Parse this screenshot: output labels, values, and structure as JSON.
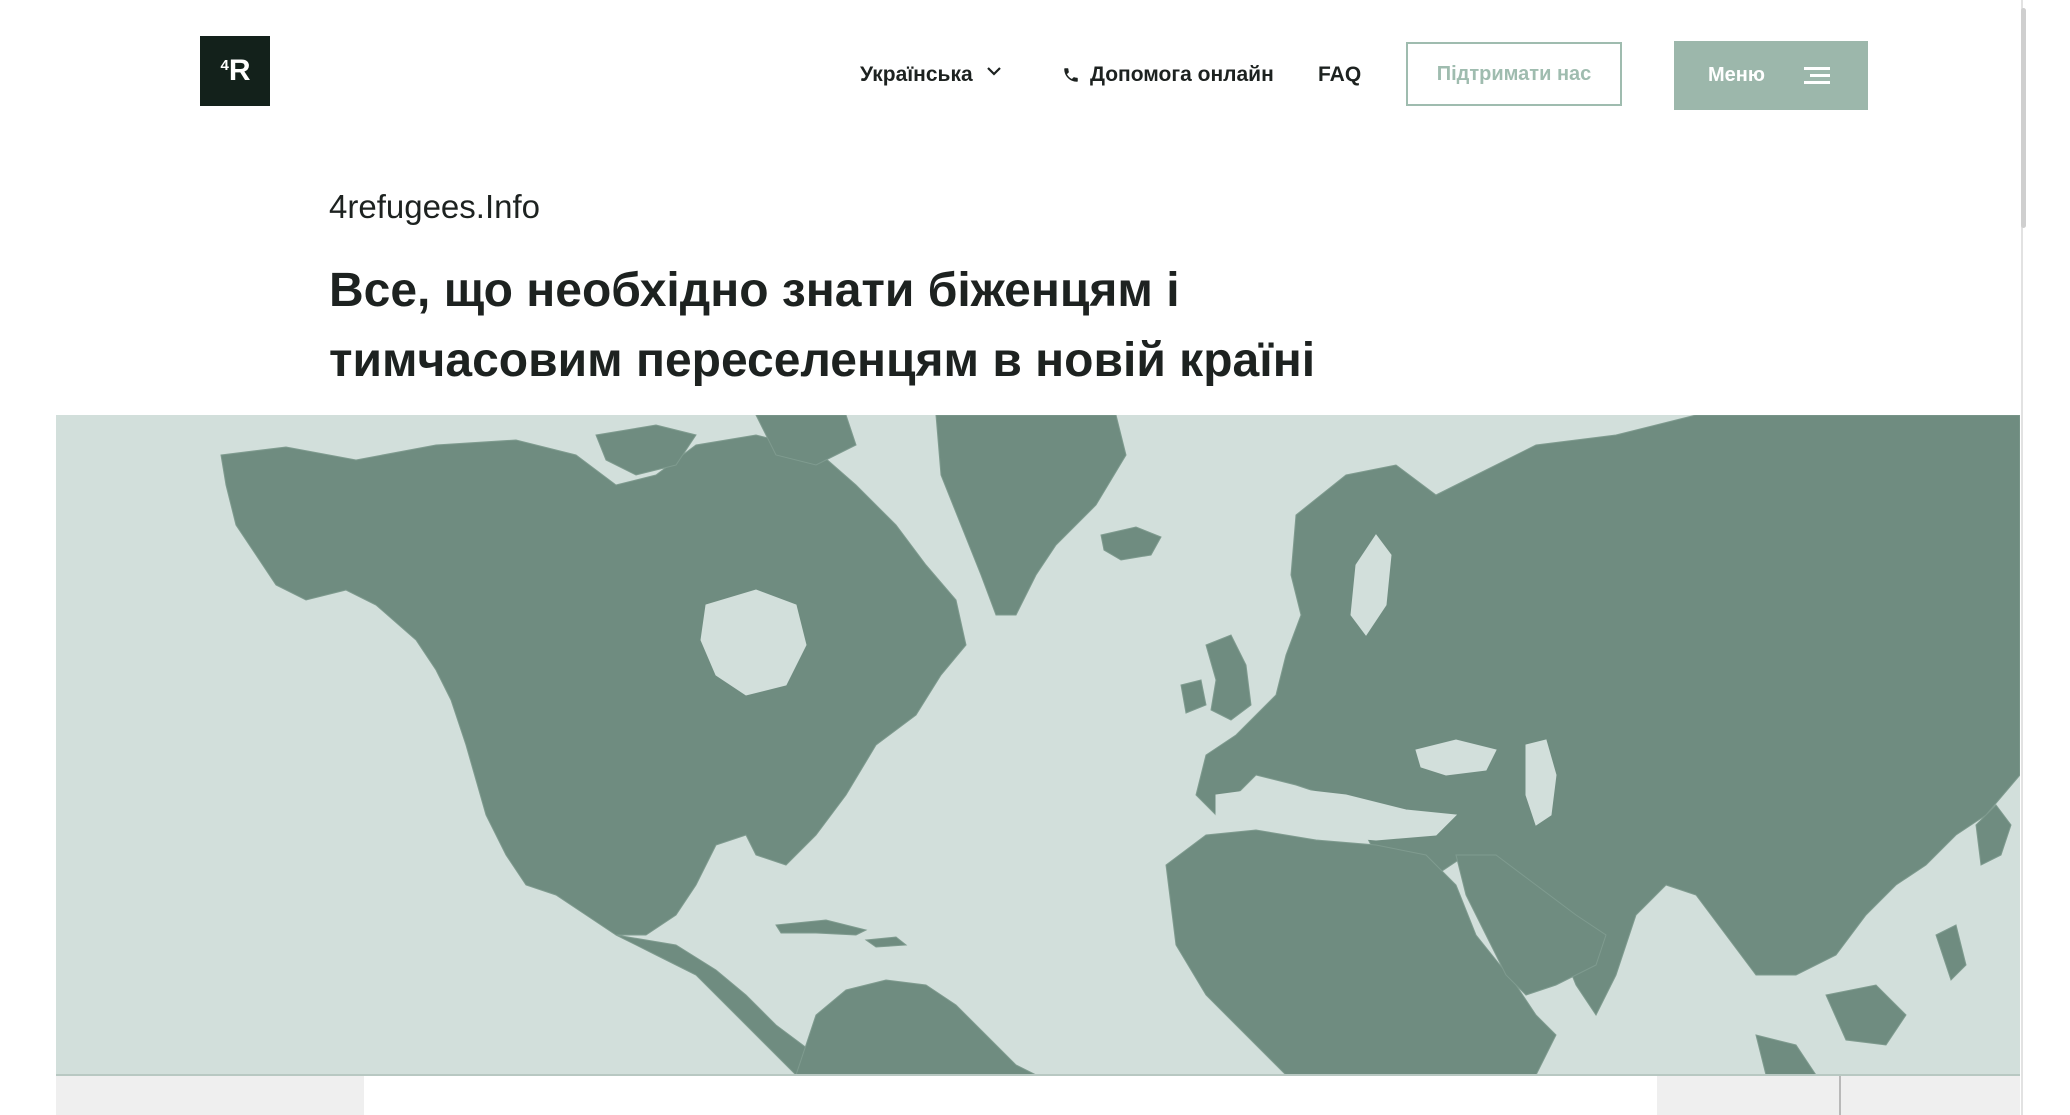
{
  "logo": {
    "sup": "4",
    "text": "R"
  },
  "nav": {
    "language": "Українська",
    "help": "Допомога онлайн",
    "faq": "FAQ",
    "support": "Підтримати нас",
    "menu": "Меню"
  },
  "hero": {
    "site_name": "4refugees.Info",
    "title_line1": "Все, що необхідно знати біженцям і",
    "title_line2": "тимчасовим переселенцям в новій країні"
  },
  "colors": {
    "land": "#6f8c80",
    "ocean": "#d2dfdb",
    "accent": "#9cb7ab",
    "logo_bg": "#13211b"
  },
  "icons": {
    "language_dropdown": "chevron-down-icon",
    "help": "phone-icon",
    "menu": "hamburger-icon"
  }
}
